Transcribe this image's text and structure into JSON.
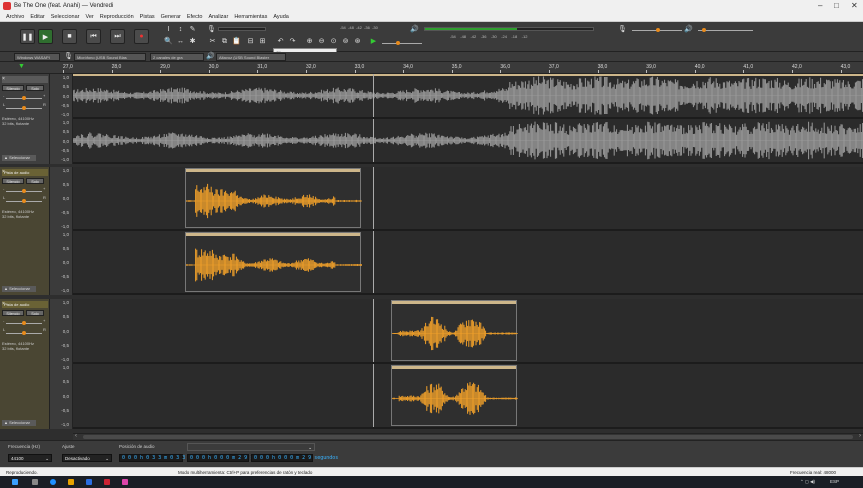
{
  "window": {
    "title": "Be The One (feat. Anahi) — Vendredi",
    "minimize": "–",
    "maximize": "□",
    "close": "✕"
  },
  "menu": [
    "Archivo",
    "Editar",
    "Seleccionar",
    "Ver",
    "Reproducción",
    "Pistas",
    "Generar",
    "Efecto",
    "Analizar",
    "Herramientas",
    "Ayuda"
  ],
  "toolbar": {
    "tip": "Clic para comenzar monitorización",
    "rec_meter_scale": [
      "-54",
      "-48",
      "-42",
      "-36",
      "-30",
      "-24",
      "-18",
      "-12",
      "-6",
      "0"
    ],
    "play_meter_scale": [
      "-54",
      "-48",
      "-42",
      "-36",
      "-30",
      "-24",
      "-18",
      "-12",
      "-6",
      "0"
    ],
    "play_level": 0.55
  },
  "devices": {
    "host": "Windows WASAPI",
    "mic": "Micrófono (USB Sound Blas",
    "channels": "2 canales de gra",
    "output": "Altavoz (USB Sound Blaster"
  },
  "ruler": [
    "27,0",
    "28,0",
    "29,0",
    "30,0",
    "31,0",
    "32,0",
    "33,0",
    "34,0",
    "35,0",
    "36,0",
    "37,0",
    "38,0",
    "39,0",
    "40,0",
    "41,0",
    "42,0",
    "43,0"
  ],
  "tracks": [
    {
      "name": "",
      "mute": "Silencio",
      "solo": "Solo",
      "gain_min": "-",
      "gain_max": "+",
      "pan_left": "L",
      "pan_right": "R",
      "info": "Estéreo, 44100Hz\n32 bits, flotante",
      "select": "Seleccionar",
      "scale_top": [
        "1,0",
        "0,5",
        "0,0",
        "-0,5",
        "-1,0"
      ],
      "scale_bottom": [
        "1,0",
        "0,5",
        "0,0",
        "-0,5",
        "-1,0"
      ]
    },
    {
      "name": "Pista de audio",
      "mute": "Silencio",
      "solo": "Solo",
      "gain_min": "-",
      "gain_max": "+",
      "pan_left": "L",
      "pan_right": "R",
      "info": "Estéreo, 44100Hz\n32 bits, flotante",
      "select": "Seleccionar",
      "scale_top": [
        "1,0",
        "0,5",
        "0,0",
        "-0,5",
        "-1,0"
      ],
      "scale_bottom": [
        "1,0",
        "0,5",
        "0,0",
        "-0,5",
        "-1,0"
      ]
    },
    {
      "name": "Pista de audio",
      "mute": "Silencio",
      "solo": "Solo",
      "gain_min": "-",
      "gain_max": "+",
      "pan_left": "L",
      "pan_right": "R",
      "info": "Estéreo, 44100Hz\n32 bits, flotante",
      "select": "Seleccionar",
      "scale_top": [
        "1,0",
        "0,5",
        "0,0",
        "-0,5",
        "-1,0"
      ],
      "scale_bottom": [
        "1,0",
        "0,5",
        "0,0",
        "-0,5",
        "-1,0"
      ]
    }
  ],
  "selection_toolbar": {
    "rate_label": "Frecuencia (Hz)",
    "rate_value": "44100",
    "snap_label": "Ajuste",
    "snap_value": "Desactivado",
    "pos_label": "Posición de audio",
    "pos_value": "0 0 0 h 0 3 3 m 0 3 3 segundos",
    "range_label": "Inicio y final de la selección",
    "start_value": "0 0 0 h 0 0 0 m 2 9 segundos",
    "end_value": "0 0 0 h 0 0 0 m 2 9 segundos"
  },
  "status": {
    "left": "Reproduciendo.",
    "center": "Modo multiherramienta: Ctrl+P para preferencias de ratón y teclado",
    "right": "Frecuencia real: 48000"
  },
  "taskbar": {
    "tray": "ESP"
  },
  "colors": {
    "selected_wave": "#f0a02a",
    "normal_wave": "#9a9a9a",
    "playhead": "#2ea82e"
  }
}
